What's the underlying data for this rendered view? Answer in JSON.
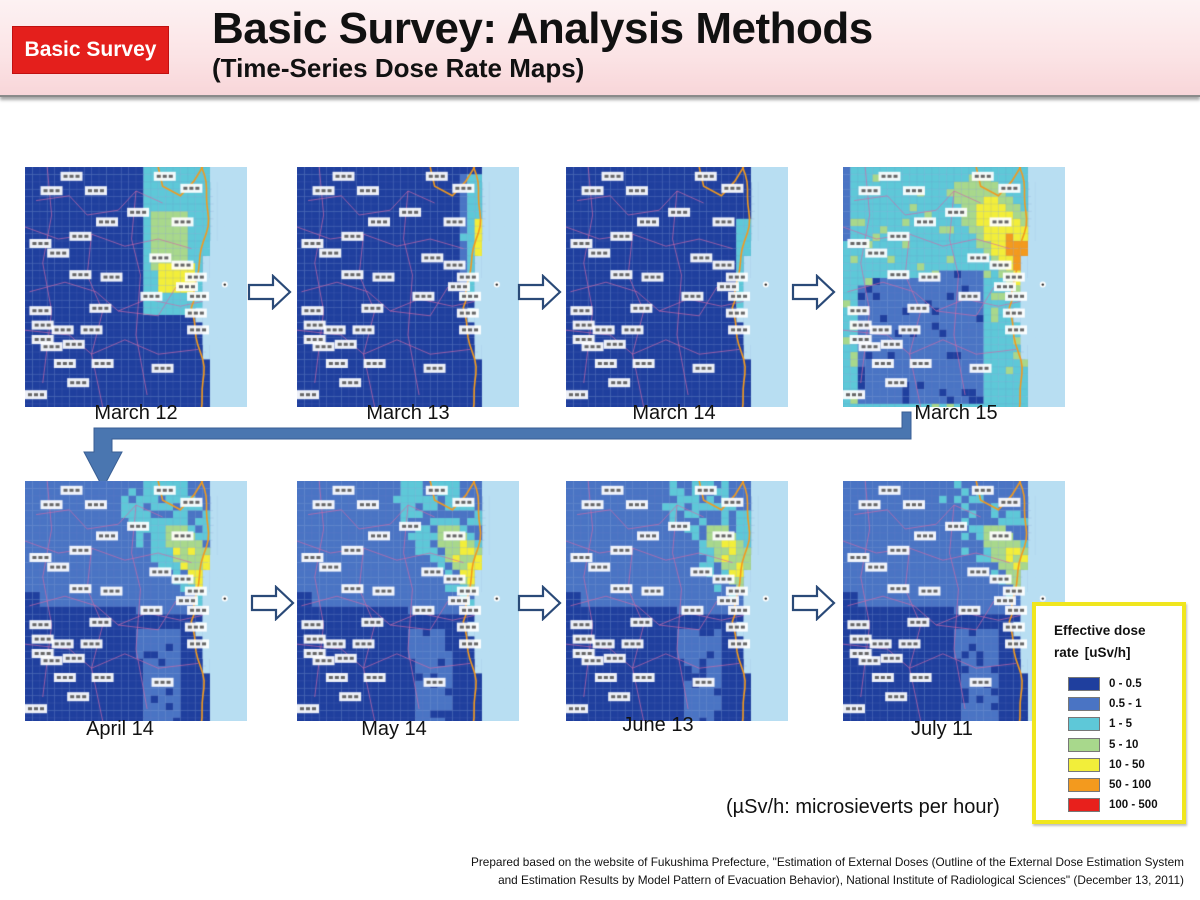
{
  "header": {
    "badge": "Basic Survey",
    "title": "Basic Survey: Analysis Methods",
    "subtitle": "(Time-Series Dose Rate Maps)"
  },
  "maps": [
    {
      "date": "March 12",
      "stage": "mar12"
    },
    {
      "date": "March 13",
      "stage": "mar13"
    },
    {
      "date": "March 14",
      "stage": "mar14"
    },
    {
      "date": "March 15",
      "stage": "mar15"
    },
    {
      "date": "April 14",
      "stage": "apr14"
    },
    {
      "date": "May 14",
      "stage": "may14"
    },
    {
      "date": "June 13",
      "stage": "jun13"
    },
    {
      "date": "July 11",
      "stage": "jul11"
    }
  ],
  "icons": {
    "next_arrow": "right-outline-arrow-icon",
    "flow_arrow": "elbow-down-arrow-icon"
  },
  "legend": {
    "title": "Effective dose rate",
    "unit": "[uSv/h]",
    "items": [
      {
        "label": "0 - 0.5",
        "color": "#1f3f9e"
      },
      {
        "label": "0.5 - 1",
        "color": "#4a74c4"
      },
      {
        "label": "1 - 5",
        "color": "#5ec8d8"
      },
      {
        "label": "5 - 10",
        "color": "#a8d88c"
      },
      {
        "label": "10 - 50",
        "color": "#f2ee3a"
      },
      {
        "label": "50 - 100",
        "color": "#f39a1e"
      },
      {
        "label": "100 - 500",
        "color": "#e8201c"
      }
    ]
  },
  "colors": {
    "badge": "#e41f1c",
    "arrow_fill": "#4a76b0",
    "legend_border": "#f0e61e",
    "sea": "#b8def2",
    "border_lines": "#d06aa8",
    "coast_line": "#f29a1e"
  },
  "unit_note": "(µSv/h: microsieverts per hour)",
  "source": {
    "line1": "Prepared based on the website of Fukushima Prefecture, \"Estimation of External Doses (Outline of the External Dose Estimation System",
    "line2": "and Estimation Results by Model Pattern of Evacuation Behavior), National Institute of Radiological Sciences\" (December 13, 2011)"
  }
}
